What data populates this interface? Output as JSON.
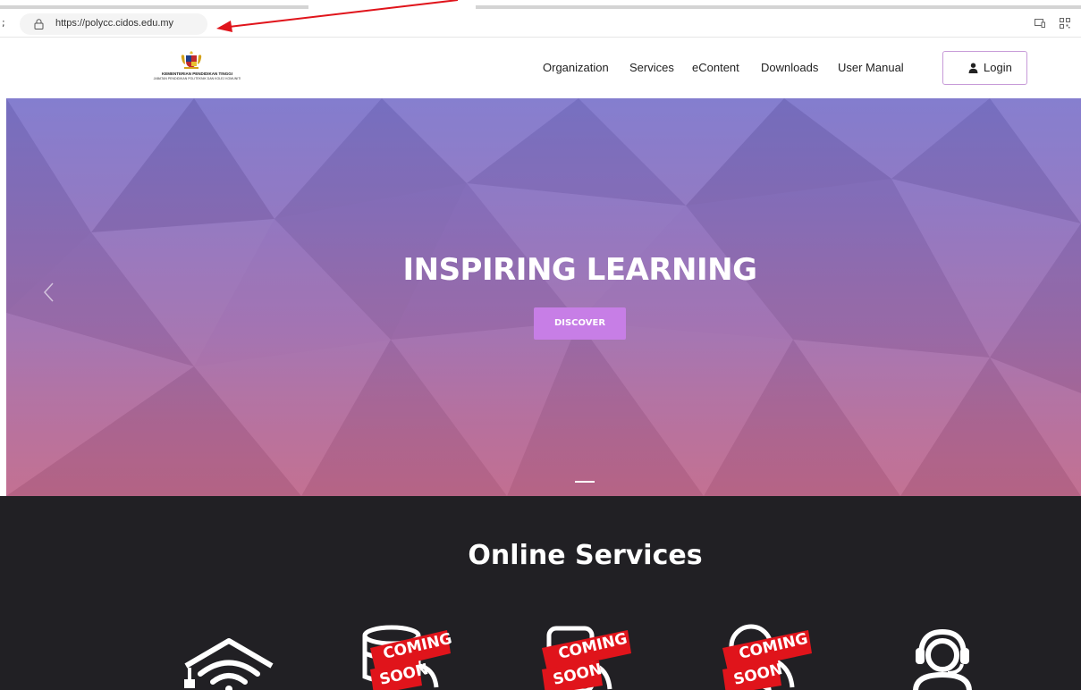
{
  "browser": {
    "address_prefix": ";",
    "url": "https://polycc.cidos.edu.my"
  },
  "logo": {
    "line1": "KEMENTERIAN PENDIDIKAN TINGGI",
    "line2": "JABATAN PENDIDIKAN POLITEKNIK DAN KOLEJ KOMUNITI"
  },
  "nav": {
    "items": [
      "Organization",
      "Services",
      "eContent",
      "Downloads",
      "User Manual"
    ],
    "login_label": "Login"
  },
  "hero": {
    "title": "INSPIRING LEARNING",
    "button": "DISCOVER"
  },
  "services": {
    "title": "Online Services",
    "badge_line1": "COMING",
    "badge_line2": "SOON",
    "icons": [
      "graduation-wifi-icon",
      "database-icon",
      "document-icon",
      "certificate-icon",
      "support-headset-icon"
    ]
  },
  "colors": {
    "annotation_arrow": "#e0141b",
    "hero_top": "#7d76cc",
    "hero_bottom": "#c06a8d",
    "discover_button": "#c77ee6",
    "services_bg": "#212024",
    "badge_red": "#e0141b"
  }
}
